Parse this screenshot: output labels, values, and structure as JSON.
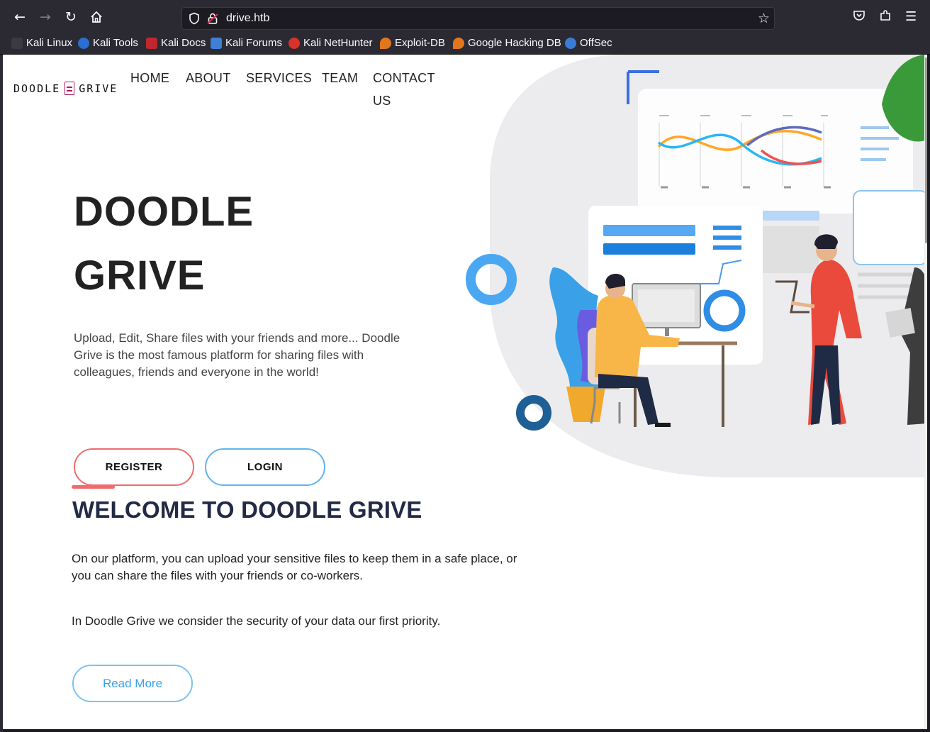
{
  "browser": {
    "url": "drive.htb",
    "bookmarks": [
      {
        "label": "Kali Linux",
        "icon": "kali-dragon-icon",
        "color": "#3f7fd6"
      },
      {
        "label": "Kali Tools",
        "icon": "kali-tools-icon",
        "color": "#2a6fd1"
      },
      {
        "label": "Kali Docs",
        "icon": "kali-docs-icon",
        "color": "#c0262d"
      },
      {
        "label": "Kali Forums",
        "icon": "kali-forums-icon",
        "color": "#3f7fd6"
      },
      {
        "label": "Kali NetHunter",
        "icon": "nethunter-icon",
        "color": "#d8322b"
      },
      {
        "label": "Exploit-DB",
        "icon": "exploit-db-icon",
        "color": "#e1761c"
      },
      {
        "label": "Google Hacking DB",
        "icon": "ghdb-icon",
        "color": "#e1761c"
      },
      {
        "label": "OffSec",
        "icon": "offsec-icon",
        "color": "#3a7bd5"
      }
    ]
  },
  "site": {
    "logo_left": "DOODLE",
    "logo_right": "GRIVE",
    "nav": {
      "home": "HOME",
      "about": "ABOUT",
      "services": "SERVICES",
      "team": "TEAM",
      "contact_line1": "CONTACT",
      "contact_line2": "US"
    },
    "hero": {
      "title_line1": "DOODLE",
      "title_line2": "GRIVE",
      "description": "Upload, Edit, Share files with your friends and more... Doodle Grive is the most famous platform for sharing files with colleagues, friends and everyone in the world!",
      "register_label": "REGISTER",
      "login_label": "LOGIN"
    },
    "welcome": {
      "title": "WELCOME TO DOODLE GRIVE",
      "paragraph1": "On our platform, you can upload your sensitive files to keep them in a safe place, or you can share the files with your friends or co-workers.",
      "paragraph2": "In Doodle Grive we consider the security of your data our first priority.",
      "read_more_label": "Read More"
    },
    "colors": {
      "register_border": "#f06b6b",
      "login_border": "#62b2ee",
      "heading": "#222a45",
      "accent_blue": "#3aa3e8"
    }
  }
}
